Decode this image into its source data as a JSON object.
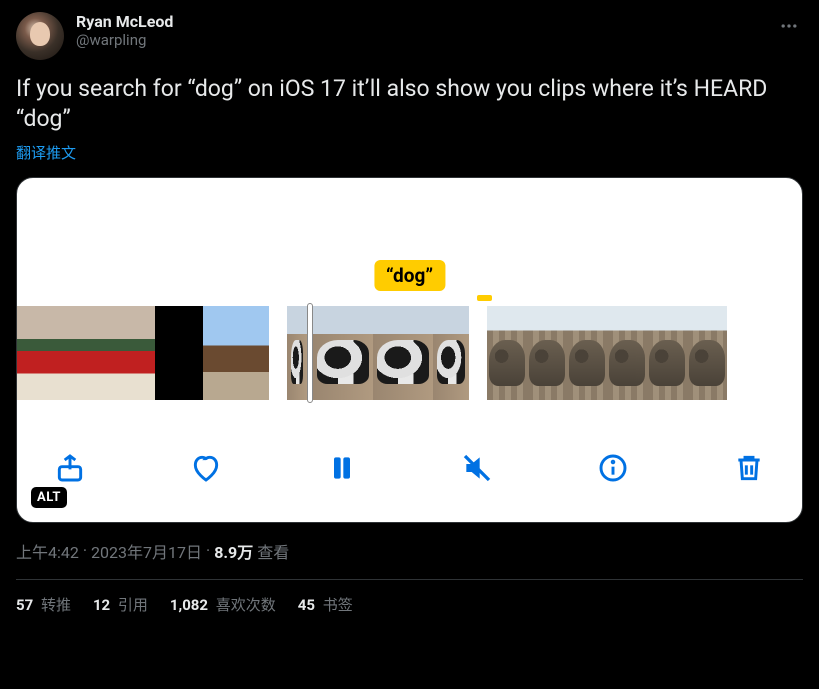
{
  "author": {
    "display_name": "Ryan McLeod",
    "handle": "@warpling"
  },
  "body_text": "If you search for “dog” on iOS 17 it’ll also show you clips where it’s HEARD “dog”",
  "translate_label": "翻译推文",
  "media": {
    "caption": "“dog”",
    "alt_badge": "ALT"
  },
  "meta": {
    "time": "上午4:42",
    "dot1": " · ",
    "date": "2023年7月17日",
    "dot2": " · ",
    "views_count": "8.9万",
    "views_label": " 查看"
  },
  "stats": {
    "retweets_n": "57",
    "retweets_label": " 转推",
    "quotes_n": "12",
    "quotes_label": " 引用",
    "likes_n": "1,082",
    "likes_label": " 喜欢次数",
    "bookmarks_n": "45",
    "bookmarks_label": " 书签"
  }
}
